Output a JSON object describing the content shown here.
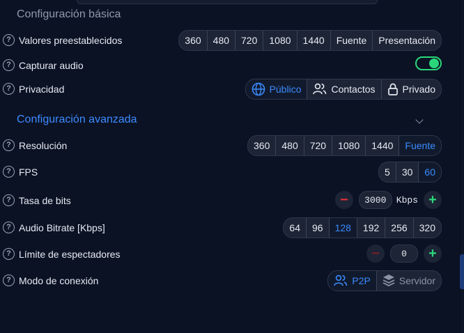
{
  "basic": {
    "title": "Configuración básica",
    "presets": {
      "label": "Valores preestablecidos",
      "options": [
        "360",
        "480",
        "720",
        "1080",
        "1440",
        "Fuente",
        "Presentación"
      ]
    },
    "capture_audio": {
      "label": "Capturar audio",
      "enabled": true
    },
    "privacy": {
      "label": "Privacidad",
      "options": [
        "Público",
        "Contactos",
        "Privado"
      ],
      "selected": "Público"
    }
  },
  "advanced": {
    "title": "Configuración avanzada",
    "resolution": {
      "label": "Resolución",
      "options": [
        "360",
        "480",
        "720",
        "1080",
        "1440",
        "Fuente"
      ],
      "selected": "Fuente"
    },
    "fps": {
      "label": "FPS",
      "options": [
        "5",
        "30",
        "60"
      ],
      "selected": "60"
    },
    "bitrate": {
      "label": "Tasa de bits",
      "value": "3000",
      "unit": "Kbps"
    },
    "audio_bitrate": {
      "label": "Audio Bitrate [Kbps]",
      "options": [
        "64",
        "96",
        "128",
        "192",
        "256",
        "320"
      ],
      "selected": "128"
    },
    "viewer_limit": {
      "label": "Límite de espectadores",
      "value": "0"
    },
    "connection_mode": {
      "label": "Modo de conexión",
      "options": [
        "P2P",
        "Servidor"
      ],
      "selected": "P2P"
    }
  },
  "help_glyph": "?",
  "colors": {
    "background": "#0b1224",
    "accent": "#3b8bff",
    "success": "#2ad67a",
    "danger": "#e0313a"
  }
}
